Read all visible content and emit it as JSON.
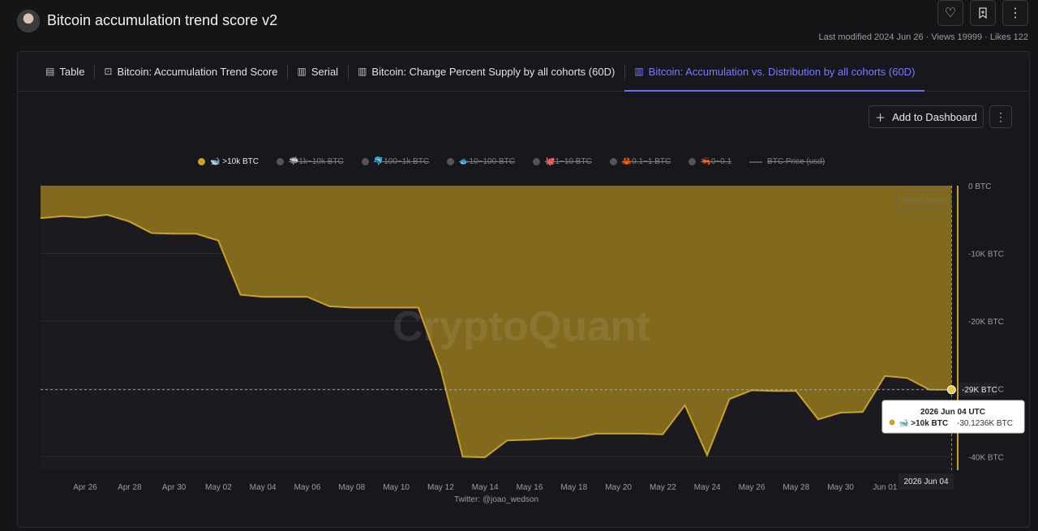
{
  "header": {
    "title": "Bitcoin accumulation trend score v2",
    "meta": "Last modified 2024 Jun 26 · Views 19999 · Likes 122",
    "actions": [
      "heart-icon",
      "bookmark-icon",
      "more-vertical-icon"
    ]
  },
  "tabs": [
    {
      "label": "Table",
      "icon": "table-icon",
      "active": false
    },
    {
      "label": "Bitcoin: Accumulation Trend Score",
      "icon": "chart-score-icon",
      "active": false
    },
    {
      "label": "Serial",
      "icon": "bar-chart-icon",
      "active": false
    },
    {
      "label": "Bitcoin: Change Percent Supply by all cohorts (60D)",
      "icon": "bar-chart-icon",
      "active": false
    },
    {
      "label": "Bitcoin: Accumulation vs. Distribution by all cohorts (60D)",
      "icon": "bar-chart-icon",
      "active": true
    }
  ],
  "toolbar": {
    "add_to_dashboard": "Add to Dashboard"
  },
  "colors": {
    "accent": "#6b6cff",
    "series": "#c9a227",
    "area": "#8a701e",
    "background": "#18171b"
  },
  "chart_data": {
    "type": "area",
    "legend": [
      {
        "label": "🐋 >10k BTC",
        "visible": true
      },
      {
        "label": "🦈1k~10k BTC",
        "visible": false
      },
      {
        "label": "🐬100~1k BTC",
        "visible": false
      },
      {
        "label": "🐟10~100 BTC",
        "visible": false
      },
      {
        "label": "🐙1~10 BTC",
        "visible": false
      },
      {
        "label": "🦀0.1~1 BTC",
        "visible": false
      },
      {
        "label": "🦐0~0.1",
        "visible": false
      },
      {
        "label": "BTC Price (usd)",
        "visible": false
      }
    ],
    "x_ticks": [
      "Apr 26",
      "Apr 28",
      "Apr 30",
      "May 02",
      "May 04",
      "May 06",
      "May 08",
      "May 10",
      "May 12",
      "May 14",
      "May 16",
      "May 18",
      "May 20",
      "May 22",
      "May 24",
      "May 26",
      "May 28",
      "May 30",
      "Jun 01"
    ],
    "y_ticks": [
      "0 BTC",
      "-10K BTC",
      "-20K BTC",
      "-30K BTC",
      "-40K BTC"
    ],
    "ylim": [
      -42000,
      0
    ],
    "series": [
      {
        "name": "🐋 >10k BTC",
        "x": [
          "Apr 24",
          "Apr 25",
          "Apr 26",
          "Apr 27",
          "Apr 28",
          "Apr 29",
          "Apr 30",
          "May 01",
          "May 02",
          "May 03",
          "May 04",
          "May 05",
          "May 06",
          "May 07",
          "May 08",
          "May 09",
          "May 10",
          "May 11",
          "May 12",
          "May 13",
          "May 14",
          "May 15",
          "May 16",
          "May 17",
          "May 18",
          "May 19",
          "May 20",
          "May 21",
          "May 22",
          "May 23",
          "May 24",
          "May 25",
          "May 26",
          "May 27",
          "May 28",
          "May 29",
          "May 30",
          "May 31",
          "Jun 01",
          "Jun 02",
          "Jun 03",
          "Jun 04"
        ],
        "values": [
          -4800,
          -4500,
          -4700,
          -4300,
          -5300,
          -7000,
          -7100,
          -7100,
          -8100,
          -16100,
          -16400,
          -16400,
          -16400,
          -17800,
          -18000,
          -18000,
          -18000,
          -18000,
          -27000,
          -40000,
          -40100,
          -37600,
          -37500,
          -37300,
          -37300,
          -36600,
          -36600,
          -36600,
          -36700,
          -32400,
          -39800,
          -31500,
          -30200,
          -30300,
          -30300,
          -34500,
          -33500,
          -33400,
          -28100,
          -28400,
          -30100,
          -30124
        ]
      }
    ],
    "crosshair": {
      "date": "2026 Jun 04",
      "value_label": "-29K BTC"
    },
    "tooltip": {
      "title": "2026 Jun 04 UTC",
      "series": "🐋 >10k BTC",
      "value": "-30.1236K BTC"
    },
    "reset_zoom": "Reset zoom",
    "watermark": "CryptoQuant",
    "credit": "Twitter: @joao_wedson"
  }
}
